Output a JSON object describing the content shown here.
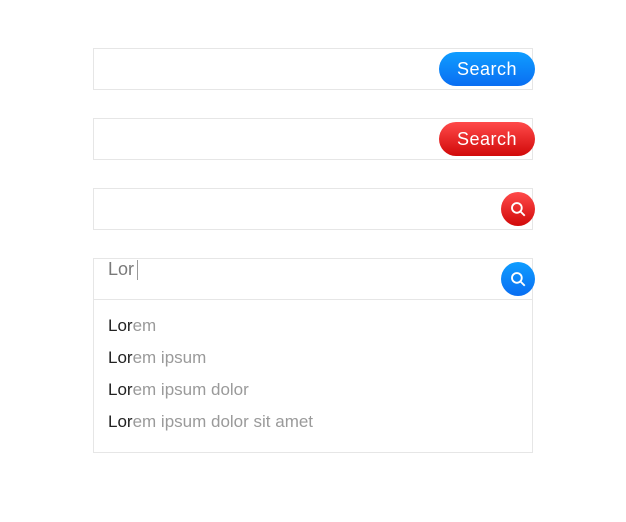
{
  "colors": {
    "blueTop": "#0f9dff",
    "blueBottom": "#0a6ef2",
    "redTop": "#ff4a4a",
    "redBottom": "#d10909",
    "border": "#e6e6e6"
  },
  "bar1": {
    "value": "",
    "placeholder": "",
    "button_label": "Search"
  },
  "bar2": {
    "value": "",
    "placeholder": "",
    "button_label": "Search"
  },
  "bar3": {
    "value": "",
    "placeholder": "",
    "icon": "search-icon"
  },
  "bar4": {
    "value": "Lor",
    "placeholder": "",
    "icon": "search-icon",
    "suggestions": [
      {
        "prefix": "Lor",
        "suffix": "em"
      },
      {
        "prefix": "Lor",
        "suffix": "em ipsum"
      },
      {
        "prefix": "Lor",
        "suffix": "em ipsum dolor"
      },
      {
        "prefix": "Lor",
        "suffix": "em ipsum dolor sit amet"
      }
    ]
  }
}
